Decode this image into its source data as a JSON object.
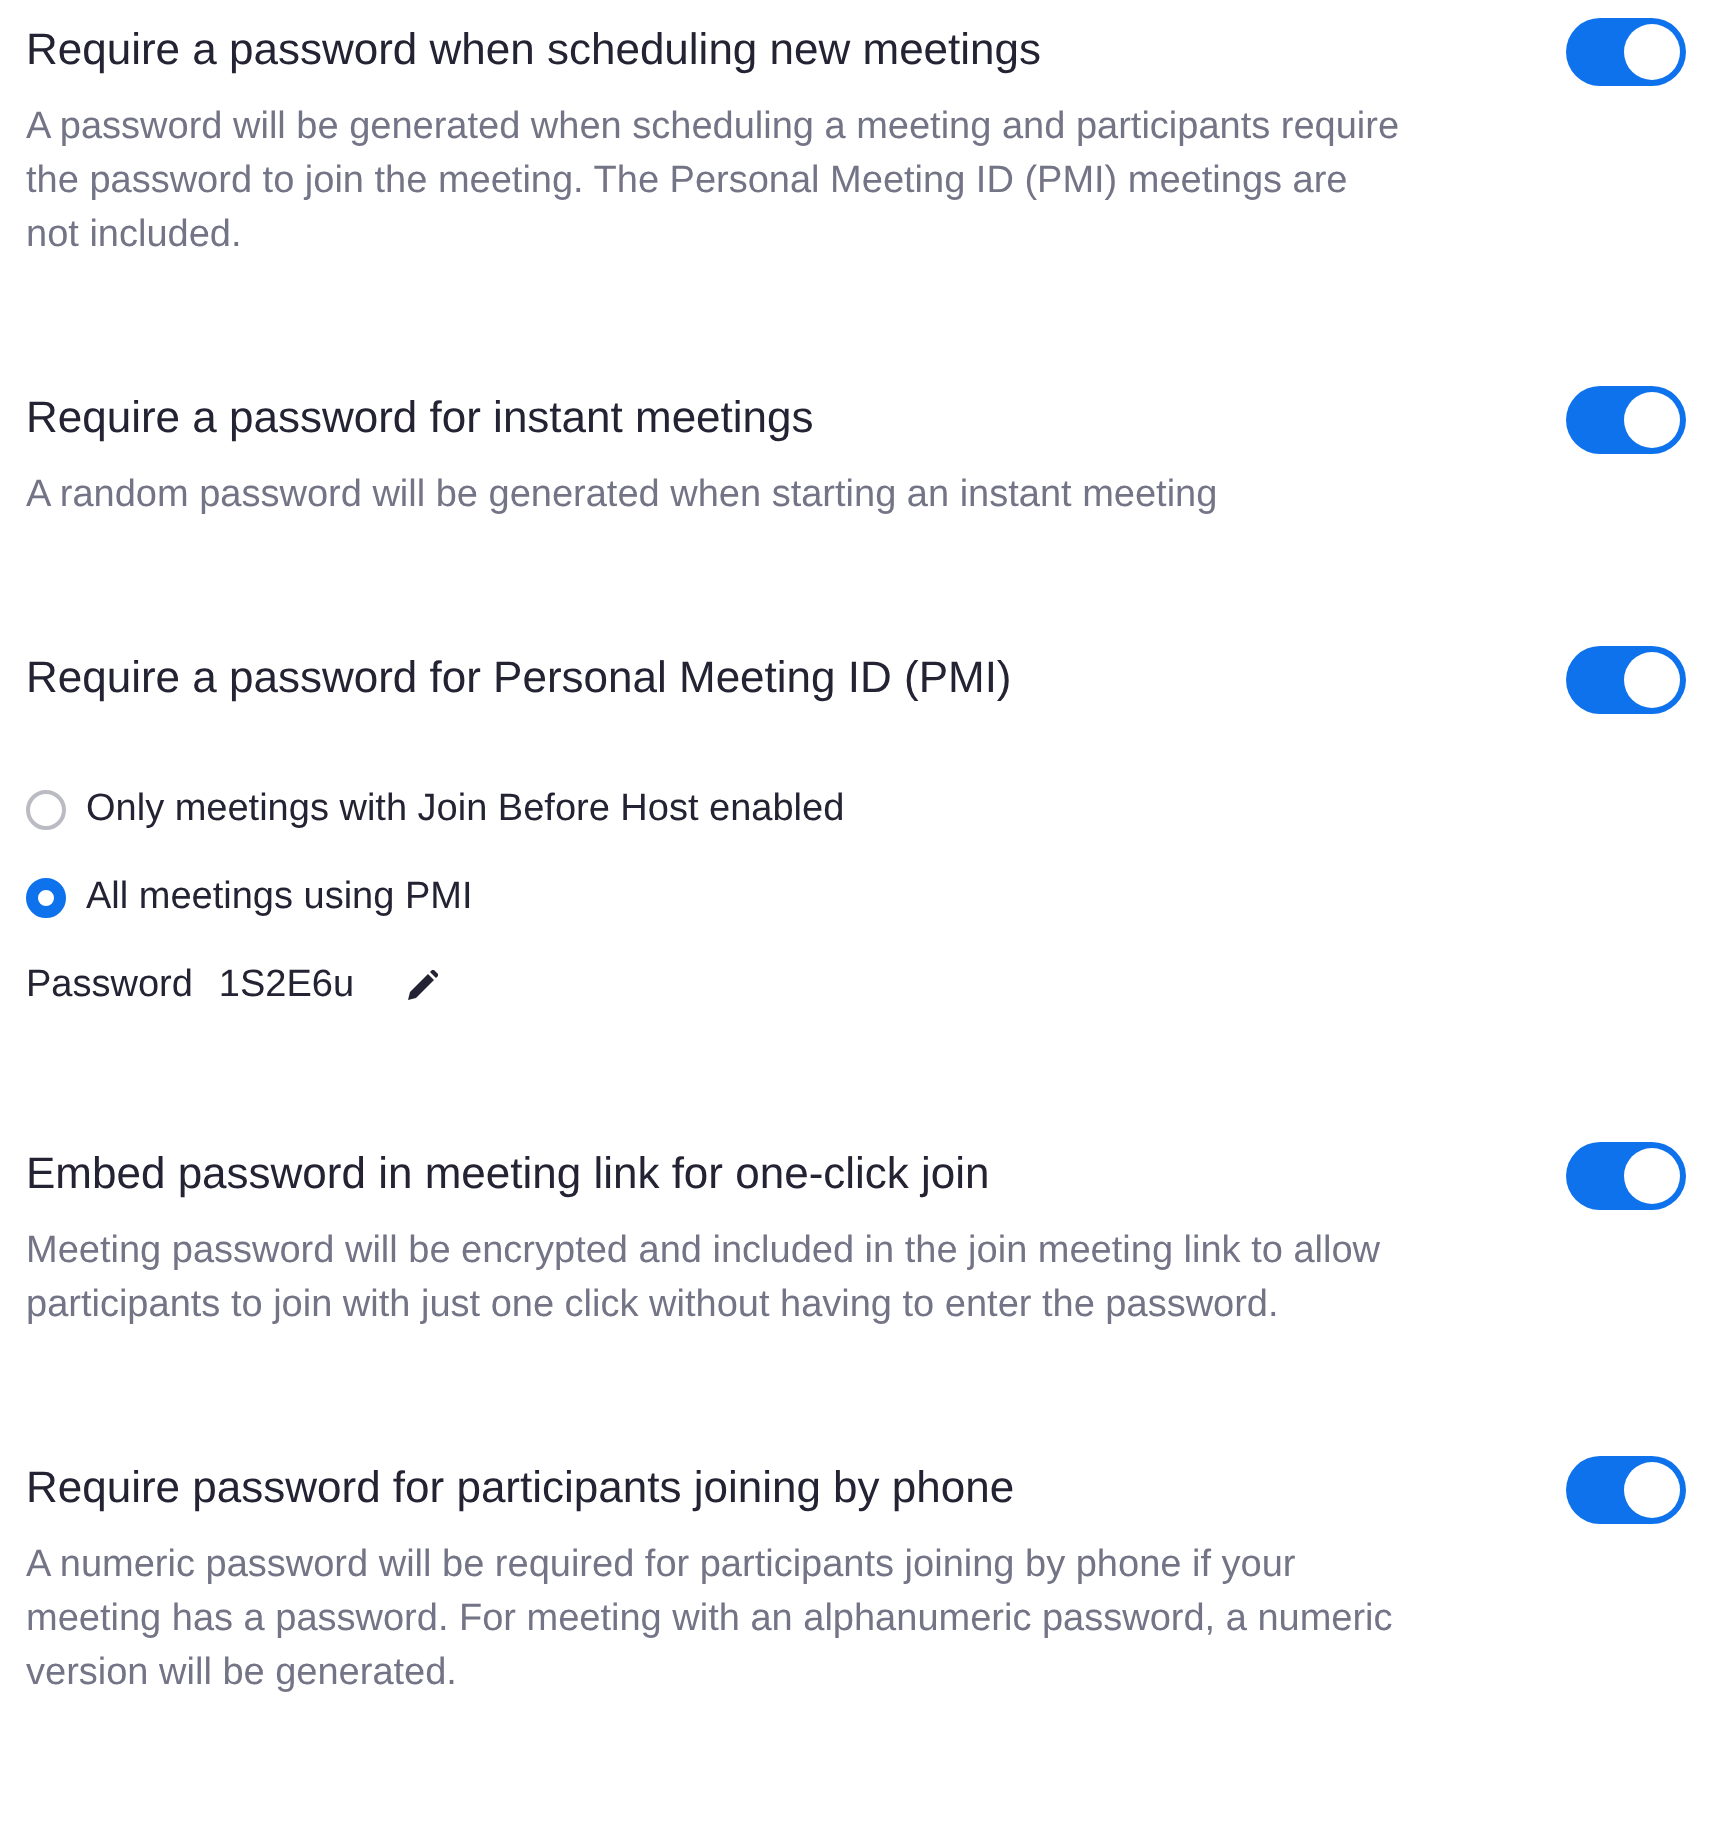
{
  "settings": [
    {
      "title": "Require a password when scheduling new meetings",
      "description": "A password will be generated when scheduling a meeting and participants require the password to join the meeting. The Personal Meeting ID (PMI) meetings are not included.",
      "on": true
    },
    {
      "title": "Require a password for instant meetings",
      "description": "A random password will be generated when starting an instant meeting",
      "on": true
    },
    {
      "title": "Require a password for Personal Meeting ID (PMI)",
      "on": true,
      "options": [
        {
          "label": "Only meetings with Join Before Host enabled",
          "selected": false
        },
        {
          "label": "All meetings using PMI",
          "selected": true
        }
      ],
      "password": {
        "label": "Password",
        "value": "1S2E6u"
      }
    },
    {
      "title": "Embed password in meeting link for one-click join",
      "description": "Meeting password will be encrypted and included in the join meeting link to allow participants to join with just one click without having to enter the password.",
      "on": true
    },
    {
      "title": "Require password for participants joining by phone",
      "description": "A numeric password will be required for participants joining by phone if your meeting has a password. For meeting with an alphanumeric password, a numeric version will be generated.",
      "on": true
    }
  ]
}
